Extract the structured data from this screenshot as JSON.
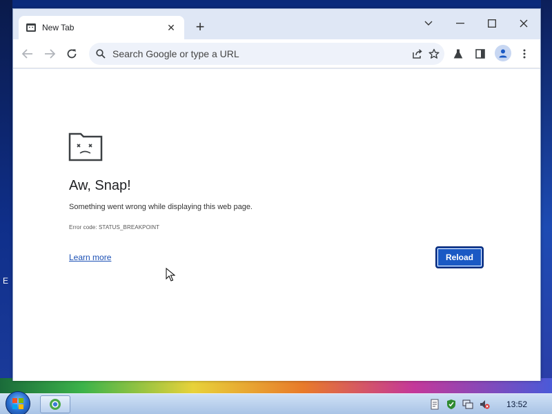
{
  "browser": {
    "tab": {
      "title": "New Tab"
    },
    "omnibox": {
      "placeholder": "Search Google or type a URL"
    }
  },
  "error_page": {
    "title": "Aw, Snap!",
    "message": "Something went wrong while displaying this web page.",
    "error_code": "Error code: STATUS_BREAKPOINT",
    "learn_more": "Learn more",
    "reload": "Reload"
  },
  "desktop": {
    "edge_label": "E"
  },
  "taskbar": {
    "clock": "13:52"
  },
  "colors": {
    "reload_button": "#1a59c4",
    "link": "#1a4fb4",
    "tab_strip": "#dfe7f5"
  },
  "icons": [
    "tab-favicon-icon",
    "close-icon",
    "plus-icon",
    "chevron-down-icon",
    "minimize-icon",
    "maximize-icon",
    "window-close-icon",
    "back-icon",
    "forward-icon",
    "reload-icon",
    "search-icon",
    "share-icon",
    "star-icon",
    "labs-flask-icon",
    "side-panel-icon",
    "profile-icon",
    "more-menu-icon",
    "sad-folder-icon",
    "start-orb-icon",
    "browser-task-icon"
  ]
}
